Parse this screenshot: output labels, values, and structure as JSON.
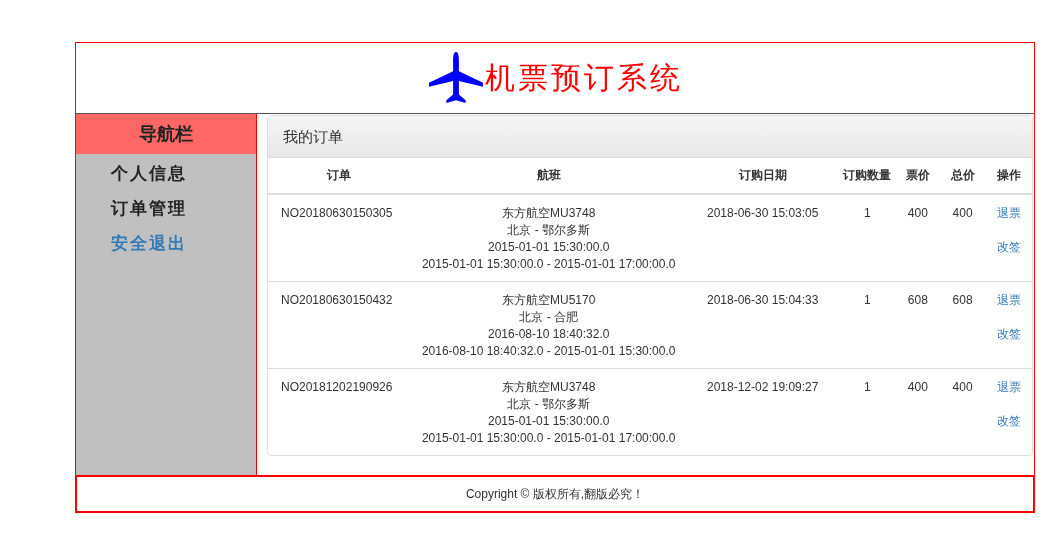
{
  "header": {
    "title": "机票预订系统"
  },
  "sidebar": {
    "title": "导航栏",
    "items": [
      {
        "label": "个人信息",
        "kind": "item"
      },
      {
        "label": "订单管理",
        "kind": "item"
      },
      {
        "label": "安全退出",
        "kind": "link"
      }
    ]
  },
  "panel": {
    "title": "我的订单",
    "table": {
      "columns": [
        "订单",
        "航班",
        "订购日期",
        "订购数量",
        "票价",
        "总价",
        "操作"
      ],
      "rows": [
        {
          "order": "NO20180630150305",
          "flight": [
            "东方航空MU3748",
            "北京 - 鄂尔多斯",
            "2015-01-01 15:30:00.0",
            "2015-01-01 15:30:00.0 - 2015-01-01 17:00:00.0"
          ],
          "date": "2018-06-30 15:03:05",
          "quantity": "1",
          "price": "400",
          "total": "400",
          "actions": [
            "退票",
            "改签"
          ]
        },
        {
          "order": "NO20180630150432",
          "flight": [
            "东方航空MU5170",
            "北京 - 合肥",
            "2016-08-10 18:40:32.0",
            "2016-08-10 18:40:32.0 - 2015-01-01 15:30:00.0"
          ],
          "date": "2018-06-30 15:04:33",
          "quantity": "1",
          "price": "608",
          "total": "608",
          "actions": [
            "退票",
            "改签"
          ]
        },
        {
          "order": "NO20181202190926",
          "flight": [
            "东方航空MU3748",
            "北京 - 鄂尔多斯",
            "2015-01-01 15:30:00.0",
            "2015-01-01 15:30:00.0 - 2015-01-01 17:00:00.0"
          ],
          "date": "2018-12-02 19:09:27",
          "quantity": "1",
          "price": "400",
          "total": "400",
          "actions": [
            "退票",
            "改签"
          ]
        }
      ]
    }
  },
  "footer": {
    "text": "Copyright © 版权所有,翻版必究！"
  }
}
